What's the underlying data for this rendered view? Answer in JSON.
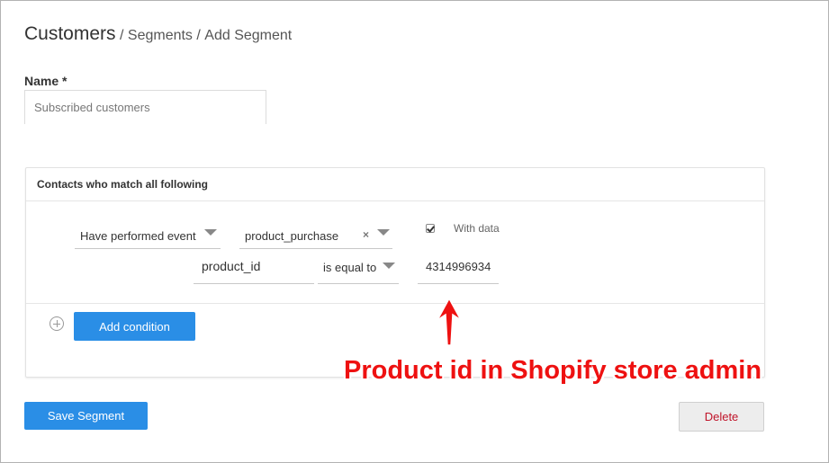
{
  "breadcrumb": {
    "title": "Customers",
    "separator": "/",
    "segments": "Segments",
    "current": "Add Segment"
  },
  "name_field": {
    "label": "Name *",
    "placeholder": "Subscribed customers"
  },
  "conditions_panel": {
    "title": "Contacts who match all following",
    "condition": {
      "type_select": "Have performed event",
      "event_select": "product_purchase",
      "clear_symbol": "×",
      "with_data_checked": true,
      "with_data_label": "With data",
      "property_field": "product_id",
      "operator_select": "is equal to",
      "value_field": "4314996934"
    },
    "add_condition_label": "Add condition"
  },
  "actions": {
    "save_label": "Save Segment",
    "delete_label": "Delete"
  },
  "annotation": {
    "text": "Product id in Shopify store admin",
    "color": "#ee1111"
  },
  "colors": {
    "primary": "#2a8ee6",
    "danger": "#c0142a"
  }
}
